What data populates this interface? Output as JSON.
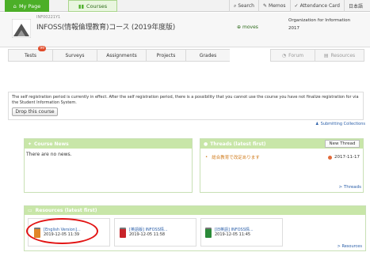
{
  "topbar": {
    "mypage_label": "My Page",
    "courses_label": "Courses",
    "nav": [
      {
        "icon": "search-icon",
        "label": "Search"
      },
      {
        "icon": "memo-icon",
        "label": "Memos"
      },
      {
        "icon": "attendance-icon",
        "label": "Attendance Card"
      },
      {
        "icon": "",
        "label": "日本語"
      }
    ]
  },
  "course": {
    "code": "INF00221Y1",
    "name": "INFOSS(情報倫理教育)コース (2019年度版)",
    "moves_label": "moves",
    "organization": [
      "Organization for Information",
      "2017"
    ]
  },
  "tabs": [
    {
      "label": "Tests",
      "badge": "99"
    },
    {
      "label": "Surveys"
    },
    {
      "label": "Assignments"
    },
    {
      "label": "Projects"
    },
    {
      "label": "Grades"
    },
    {
      "label": "Forum"
    },
    {
      "label": "Resources"
    }
  ],
  "notice": {
    "text": "The self registration period is currently in effect. After the self registration period, there is a possibility that you cannot use the course you have not finalize registration for via the Student Information System.",
    "drop_button": "Drop this course"
  },
  "submit_collection": "Submitting Collections",
  "news": {
    "title": "Course News",
    "empty": "There are no news."
  },
  "threads": {
    "title": "Threads (latest first)",
    "new_button": "New Thread",
    "items": [
      {
        "title": "総合教育で改定あります",
        "date": "2017-11-17"
      }
    ],
    "more": "> Threads"
  },
  "resources": {
    "title": "Resources (latest first)",
    "items": [
      {
        "title": "[English Version]...",
        "date": "2019-12-05 11:39",
        "color": "#e0862a"
      },
      {
        "title": "[英語版] INFOSS情...",
        "date": "2019-12-05 11:58",
        "color": "#c8242a"
      },
      {
        "title": "[旧英語] INFOSS情...",
        "date": "2019-12-05 11:45",
        "color": "#2a8a38"
      }
    ],
    "more": "> Resources"
  },
  "colors": {
    "accent": "#4caf28",
    "panel_head": "#c8e6a8",
    "highlight": "#e21414"
  }
}
